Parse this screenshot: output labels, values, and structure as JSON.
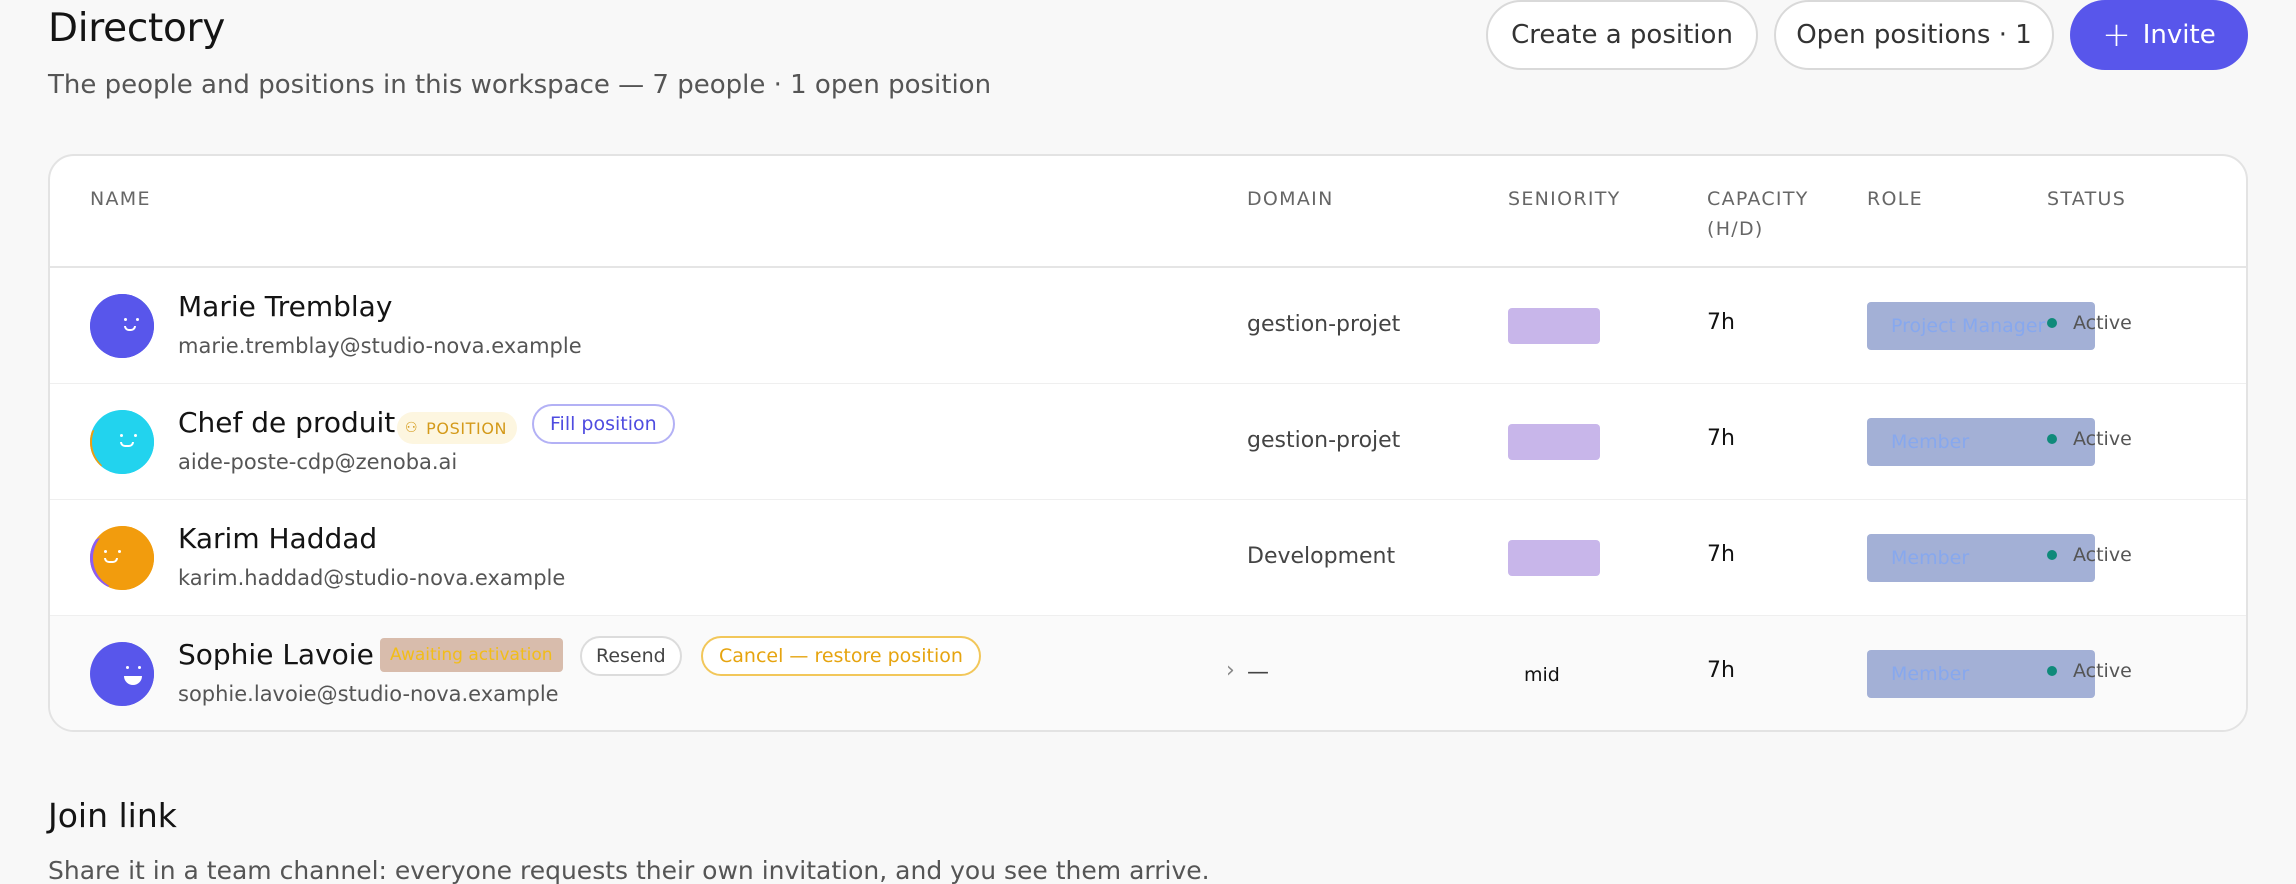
{
  "header": {
    "title": "Directory",
    "subtitle": "The people and positions in this workspace — 7 people · 1 open position",
    "create_position_label": "Create a position",
    "open_positions_label": "Open positions · 1",
    "invite_icon": "+",
    "invite_label": "Invite"
  },
  "table": {
    "columns": {
      "name": "NAME",
      "domain": "DOMAIN",
      "seniority": "SENIORITY",
      "capacity": "CAPACITY (H/D)",
      "role": "ROLE",
      "status": "STATUS"
    },
    "rows": [
      {
        "name": "Marie Tremblay",
        "email": "marie.tremblay@studio-nova.example",
        "domain": "gestion-projet",
        "seniority": "",
        "capacity": "7h",
        "role": "Project Manager",
        "status": "Active",
        "avatar_color": "#5856eb"
      },
      {
        "name": "Chef de produit",
        "email": "aide-poste-cdp@zenoba.ai",
        "position_badge": "POSITION",
        "position_icon": "user-icon",
        "fill_label": "Fill position",
        "domain": "gestion-projet",
        "seniority": "",
        "capacity": "7h",
        "role": "Member",
        "status": "Active",
        "avatar_color": "#22d3ee"
      },
      {
        "name": "Karim Haddad",
        "email": "karim.haddad@studio-nova.example",
        "domain": "Development",
        "seniority": "",
        "capacity": "7h",
        "role": "Member",
        "status": "Active",
        "avatar_color": "#f29c0d"
      },
      {
        "name": "Sophie Lavoie",
        "email": "sophie.lavoie@studio-nova.example",
        "awaiting_label": "Awaiting activation",
        "resend_label": "Resend",
        "cancel_label": "Cancel — restore position",
        "chevron": "›",
        "domain": "—",
        "seniority": "mid",
        "capacity": "7h",
        "role": "Member",
        "status": "Active",
        "avatar_color": "#5856eb"
      }
    ]
  },
  "join_link": {
    "title": "Join link",
    "subtitle": "Share it in a team channel: everyone requests their own invitation, and you see them arrive."
  },
  "colors": {
    "accent": "#5856eb",
    "status_active": "#0f8a7a",
    "position_badge": "#d49a1a"
  }
}
